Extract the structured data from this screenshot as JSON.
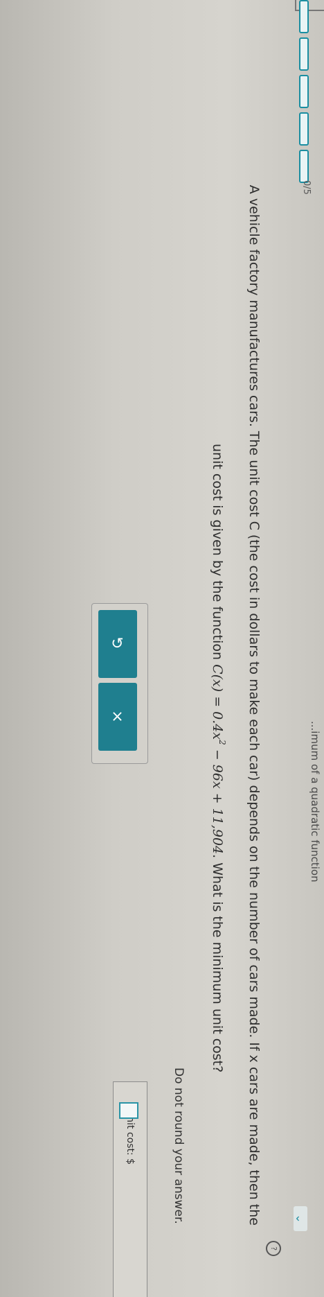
{
  "header": {
    "topic_fragment": "...imum of a quadratic function",
    "progress_label": "0/5",
    "progress_segments": 5,
    "progress_filled": 0
  },
  "question": {
    "line1": "A vehicle factory manufactures cars. The unit cost C (the cost in dollars to make each car) depends on the number of cars made. If x cars are made, then the",
    "line2_prefix": "unit cost is given by the function",
    "line2_formula_left": "C(x) = 0.4x",
    "line2_exponent": "2",
    "line2_formula_right": "− 96x + 11,904",
    "line2_suffix": ". What is the minimum unit cost?",
    "note": "Do not round your answer."
  },
  "answer": {
    "label": "Unit cost: $",
    "value": ""
  },
  "actions": {
    "clear_label": "×",
    "undo_label": "↺"
  },
  "colors": {
    "accent": "#1f7f8f",
    "accent_light": "#2a94a6"
  },
  "icons": {
    "expand": "chevron-down-icon",
    "clear": "close-icon",
    "undo": "undo-icon",
    "help": "question-icon"
  }
}
